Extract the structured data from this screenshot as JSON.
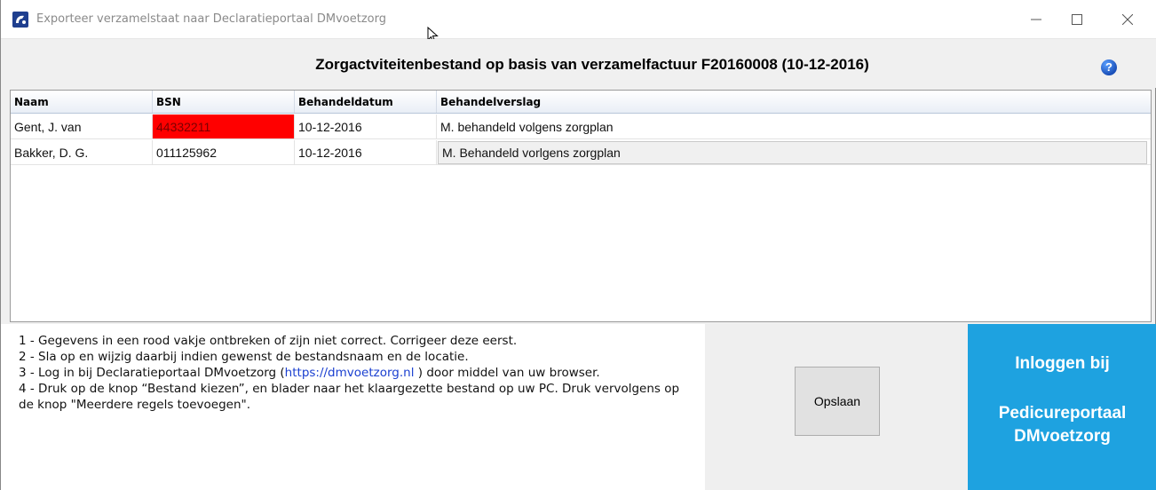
{
  "window": {
    "title": "Exporteer verzamelstaat naar Declaratieportaal DMvoetzorg",
    "controls": {
      "minimize": "—",
      "maximize": "☐",
      "close": "✕"
    }
  },
  "header": {
    "heading": "Zorgactviteitenbestand op basis van verzamelfactuur F20160008 (10-12-2016)",
    "help_icon": "?"
  },
  "table": {
    "columns": [
      "Naam",
      "BSN",
      "Behandeldatum",
      "Behandelverslag"
    ],
    "rows": [
      {
        "naam": "Gent, J. van",
        "bsn": "44332211",
        "datum": "10-12-2016",
        "verslag": "M. behandeld volgens zorgplan",
        "bsn_invalid": true
      },
      {
        "naam": "Bakker, D. G.",
        "bsn": "011125962",
        "datum": "10-12-2016",
        "verslag": "M. Behandeld vorlgens zorgplan",
        "bsn_invalid": false
      }
    ]
  },
  "instructions": {
    "line1": "1 - Gegevens in een rood vakje ontbreken of zijn niet correct. Corrigeer deze eerst.",
    "line2": "2 - Sla op en wijzig daarbij indien gewenst de bestandsnaam en de locatie.",
    "line3_pre": "3 - Log in bij Declaratieportaal DMvoetzorg (",
    "line3_link": "https://dmvoetzorg.nl",
    "line3_post": " ) door middel van uw browser.",
    "line4": "4 - Druk op de knop “Bestand kiezen”, en blader naar het klaargezette bestand op uw PC. Druk vervolgens op de knop \"Meerdere regels toevoegen\"."
  },
  "buttons": {
    "save": "Opslaan",
    "login_line1": "Inloggen bij",
    "login_line2": "Pedicureportaal",
    "login_line3": "DMvoetzorg"
  },
  "colors": {
    "error_cell": "#ff0000",
    "login_panel": "#1ea2e0",
    "link": "#1a3fd0"
  }
}
